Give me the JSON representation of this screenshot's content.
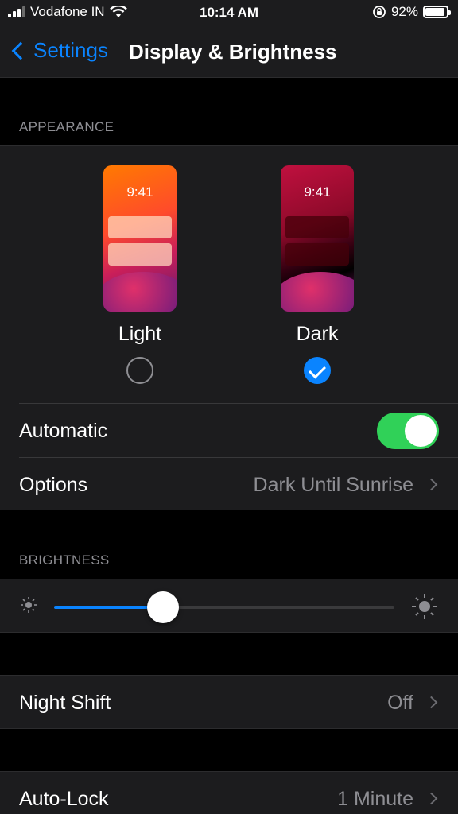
{
  "status_bar": {
    "carrier": "Vodafone IN",
    "time": "10:14 AM",
    "battery": "92%",
    "battery_level": 0.92,
    "icons": [
      "signal-icon",
      "wifi-icon",
      "orientation-lock-icon",
      "battery-icon"
    ]
  },
  "nav": {
    "back_label": "Settings",
    "title": "Display & Brightness"
  },
  "appearance": {
    "header": "APPEARANCE",
    "light": {
      "preview_time": "9:41",
      "label": "Light",
      "selected": false
    },
    "dark": {
      "preview_time": "9:41",
      "label": "Dark",
      "selected": true
    },
    "automatic_label": "Automatic",
    "automatic_on": true,
    "options_label": "Options",
    "options_value": "Dark Until Sunrise"
  },
  "brightness": {
    "header": "BRIGHTNESS",
    "level": 0.32
  },
  "night_shift": {
    "label": "Night Shift",
    "value": "Off"
  },
  "auto_lock": {
    "label": "Auto-Lock",
    "value": "1 Minute"
  },
  "colors": {
    "accent": "#0a84ff",
    "toggle_on": "#30d158",
    "cell_bg": "#1c1c1e",
    "secondary_text": "#8e8e93"
  }
}
